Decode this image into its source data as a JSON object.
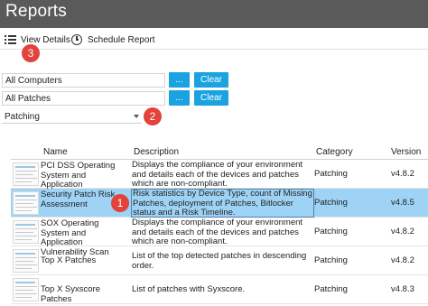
{
  "app": {
    "title": "Reports"
  },
  "toolbar": {
    "view_details_label": "View Details",
    "schedule_report_label": "Schedule Report"
  },
  "filters": {
    "computers_value": "All Computers",
    "patches_value": "All Patches",
    "browse_label": "...",
    "clear_label": "Clear",
    "category_selected": "Patching"
  },
  "badges": {
    "one": "1",
    "two": "2",
    "three": "3"
  },
  "table": {
    "headers": {
      "name": "Name",
      "description": "Description",
      "category": "Category",
      "version": "Version"
    },
    "rows": [
      {
        "name": "PCI DSS Operating System and Application Vulnerability Scan",
        "description": "Displays the compliance of your environment and details each of the devices and patches which are non-compliant.",
        "category": "Patching",
        "version": "v4.8.2"
      },
      {
        "name": "Security Patch Risk Assessment",
        "description": "Risk statistics by Device Type, count of Missing Patches, deployment of Patches, Bitlocker status and a Risk Timeline.",
        "category": "Patching",
        "version": "v4.8.5"
      },
      {
        "name": "SOX Operating System and Application Vulnerability Scan",
        "description": "Displays the compliance of your environment and details each of the devices and patches which are non-compliant.",
        "category": "Patching",
        "version": "v4.8.2"
      },
      {
        "name": "Top X Patches",
        "description": "List of the top detected patches in descending order.",
        "category": "Patching",
        "version": "v4.8.2"
      },
      {
        "name": "Top X Syxscore Patches",
        "description": "List of patches with Syxscore.",
        "category": "Patching",
        "version": "v4.8.3"
      }
    ]
  },
  "colors": {
    "titlebar": "#5a5a5a",
    "accent_button": "#1aa3e0",
    "selected_row": "#9fd3f6",
    "badge": "#e2433a"
  }
}
